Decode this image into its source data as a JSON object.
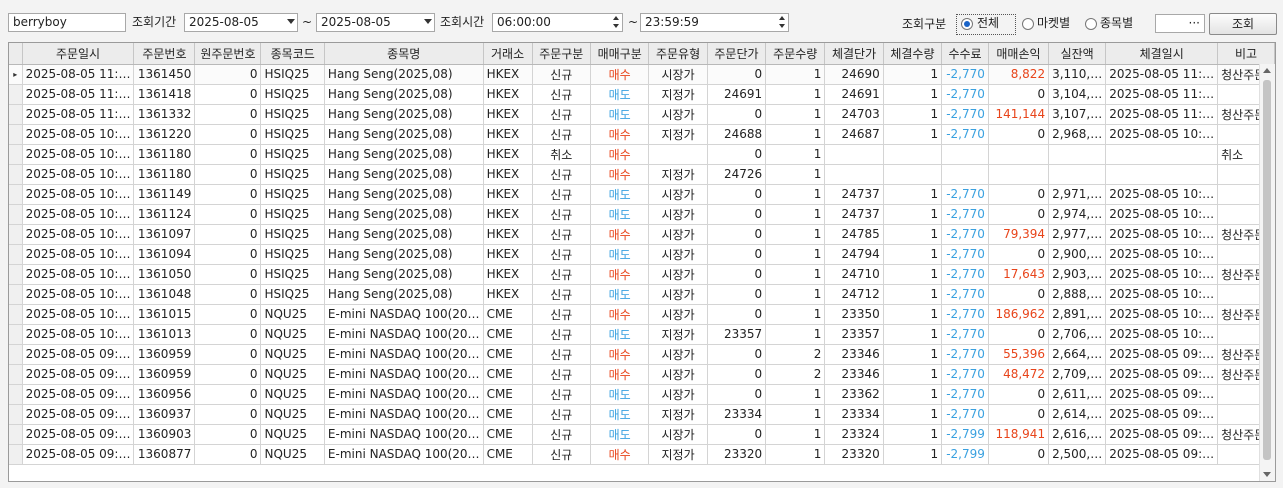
{
  "toolbar": {
    "account_value": "berryboy",
    "period_label": "조회기간",
    "date_from": "2025-08-05",
    "tilde1": "~",
    "date_to": "2025-08-05",
    "time_label": "조회시간",
    "time_from": "06:00:00",
    "tilde2": "~",
    "time_to": "23:59:59",
    "type_label": "조회구분",
    "radio_all": "전체",
    "radio_market": "마켓별",
    "radio_symbol": "종목별",
    "radio_selected": "전체",
    "extra_field": "···",
    "search_button": "조회"
  },
  "table": {
    "columns": [
      "주문일시",
      "주문번호",
      "원주문번호",
      "종목코드",
      "종목명",
      "거래소",
      "주문구분",
      "매매구분",
      "주문유형",
      "주문단가",
      "주문수량",
      "체결단가",
      "체결수량",
      "수수료",
      "매매손익",
      "실잔액",
      "체결일시",
      "비고"
    ],
    "rows": [
      [
        "2025-08-05 11:…",
        "1361450",
        "0",
        "HSIQ25",
        "Hang Seng(2025,08)",
        "HKEX",
        "신규",
        "매수",
        "시장가",
        "0",
        "1",
        "24690",
        "1",
        "-2,770",
        "8,822",
        "3,110,…",
        "2025-08-05 11:…",
        "청산주문"
      ],
      [
        "2025-08-05 11:…",
        "1361418",
        "0",
        "HSIQ25",
        "Hang Seng(2025,08)",
        "HKEX",
        "신규",
        "매도",
        "지정가",
        "24691",
        "1",
        "24691",
        "1",
        "-2,770",
        "0",
        "3,104,…",
        "2025-08-05 11:…",
        ""
      ],
      [
        "2025-08-05 11:…",
        "1361332",
        "0",
        "HSIQ25",
        "Hang Seng(2025,08)",
        "HKEX",
        "신규",
        "매도",
        "시장가",
        "0",
        "1",
        "24703",
        "1",
        "-2,770",
        "141,144",
        "3,107,…",
        "2025-08-05 11:…",
        "청산주문"
      ],
      [
        "2025-08-05 10:…",
        "1361220",
        "0",
        "HSIQ25",
        "Hang Seng(2025,08)",
        "HKEX",
        "신규",
        "매수",
        "지정가",
        "24688",
        "1",
        "24687",
        "1",
        "-2,770",
        "0",
        "2,968,…",
        "2025-08-05 10:…",
        ""
      ],
      [
        "2025-08-05 10:…",
        "1361180",
        "0",
        "HSIQ25",
        "Hang Seng(2025,08)",
        "HKEX",
        "취소",
        "매수",
        "",
        "0",
        "1",
        "",
        "",
        "",
        "",
        "",
        "",
        "취소"
      ],
      [
        "2025-08-05 10:…",
        "1361180",
        "0",
        "HSIQ25",
        "Hang Seng(2025,08)",
        "HKEX",
        "신규",
        "매수",
        "지정가",
        "24726",
        "1",
        "",
        "",
        "",
        "",
        "",
        "",
        ""
      ],
      [
        "2025-08-05 10:…",
        "1361149",
        "0",
        "HSIQ25",
        "Hang Seng(2025,08)",
        "HKEX",
        "신규",
        "매도",
        "시장가",
        "0",
        "1",
        "24737",
        "1",
        "-2,770",
        "0",
        "2,971,…",
        "2025-08-05 10:…",
        ""
      ],
      [
        "2025-08-05 10:…",
        "1361124",
        "0",
        "HSIQ25",
        "Hang Seng(2025,08)",
        "HKEX",
        "신규",
        "매도",
        "시장가",
        "0",
        "1",
        "24737",
        "1",
        "-2,770",
        "0",
        "2,974,…",
        "2025-08-05 10:…",
        ""
      ],
      [
        "2025-08-05 10:…",
        "1361097",
        "0",
        "HSIQ25",
        "Hang Seng(2025,08)",
        "HKEX",
        "신규",
        "매수",
        "시장가",
        "0",
        "1",
        "24785",
        "1",
        "-2,770",
        "79,394",
        "2,977,…",
        "2025-08-05 10:…",
        "청산주문"
      ],
      [
        "2025-08-05 10:…",
        "1361094",
        "0",
        "HSIQ25",
        "Hang Seng(2025,08)",
        "HKEX",
        "신규",
        "매도",
        "시장가",
        "0",
        "1",
        "24794",
        "1",
        "-2,770",
        "0",
        "2,900,…",
        "2025-08-05 10:…",
        ""
      ],
      [
        "2025-08-05 10:…",
        "1361050",
        "0",
        "HSIQ25",
        "Hang Seng(2025,08)",
        "HKEX",
        "신규",
        "매수",
        "시장가",
        "0",
        "1",
        "24710",
        "1",
        "-2,770",
        "17,643",
        "2,903,…",
        "2025-08-05 10:…",
        "청산주문"
      ],
      [
        "2025-08-05 10:…",
        "1361048",
        "0",
        "HSIQ25",
        "Hang Seng(2025,08)",
        "HKEX",
        "신규",
        "매도",
        "시장가",
        "0",
        "1",
        "24712",
        "1",
        "-2,770",
        "0",
        "2,888,…",
        "2025-08-05 10:…",
        ""
      ],
      [
        "2025-08-05 10:…",
        "1361015",
        "0",
        "NQU25",
        "E-mini NASDAQ 100(20…",
        "CME",
        "신규",
        "매수",
        "시장가",
        "0",
        "1",
        "23350",
        "1",
        "-2,770",
        "186,962",
        "2,891,…",
        "2025-08-05 10:…",
        "청산주문"
      ],
      [
        "2025-08-05 10:…",
        "1361013",
        "0",
        "NQU25",
        "E-mini NASDAQ 100(20…",
        "CME",
        "신규",
        "매도",
        "지정가",
        "23357",
        "1",
        "23357",
        "1",
        "-2,770",
        "0",
        "2,706,…",
        "2025-08-05 10:…",
        ""
      ],
      [
        "2025-08-05 09:…",
        "1360959",
        "0",
        "NQU25",
        "E-mini NASDAQ 100(20…",
        "CME",
        "신규",
        "매수",
        "시장가",
        "0",
        "2",
        "23346",
        "1",
        "-2,770",
        "55,396",
        "2,664,…",
        "2025-08-05 09:…",
        "청산주문"
      ],
      [
        "2025-08-05 09:…",
        "1360959",
        "0",
        "NQU25",
        "E-mini NASDAQ 100(20…",
        "CME",
        "신규",
        "매수",
        "시장가",
        "0",
        "2",
        "23346",
        "1",
        "-2,770",
        "48,472",
        "2,709,…",
        "2025-08-05 09:…",
        "청산주문"
      ],
      [
        "2025-08-05 09:…",
        "1360956",
        "0",
        "NQU25",
        "E-mini NASDAQ 100(20…",
        "CME",
        "신규",
        "매도",
        "시장가",
        "0",
        "1",
        "23362",
        "1",
        "-2,770",
        "0",
        "2,611,…",
        "2025-08-05 09:…",
        ""
      ],
      [
        "2025-08-05 09:…",
        "1360937",
        "0",
        "NQU25",
        "E-mini NASDAQ 100(20…",
        "CME",
        "신규",
        "매도",
        "지정가",
        "23334",
        "1",
        "23334",
        "1",
        "-2,770",
        "0",
        "2,614,…",
        "2025-08-05 09:…",
        ""
      ],
      [
        "2025-08-05 09:…",
        "1360903",
        "0",
        "NQU25",
        "E-mini NASDAQ 100(20…",
        "CME",
        "신규",
        "매도",
        "시장가",
        "0",
        "1",
        "23324",
        "1",
        "-2,799",
        "118,941",
        "2,616,…",
        "2025-08-05 09:…",
        "청산주문"
      ],
      [
        "2025-08-05 09:…",
        "1360877",
        "0",
        "NQU25",
        "E-mini NASDAQ 100(20…",
        "CME",
        "신규",
        "매수",
        "지정가",
        "23320",
        "1",
        "23320",
        "1",
        "-2,799",
        "0",
        "2,500,…",
        "2025-08-05 09:…",
        ""
      ]
    ],
    "current_row_marker": "▸",
    "colors": {
      "buy": "#e8441a",
      "sell": "#3aa1e0",
      "fee": "#3aa1e0",
      "profit": "#e8441a"
    }
  }
}
